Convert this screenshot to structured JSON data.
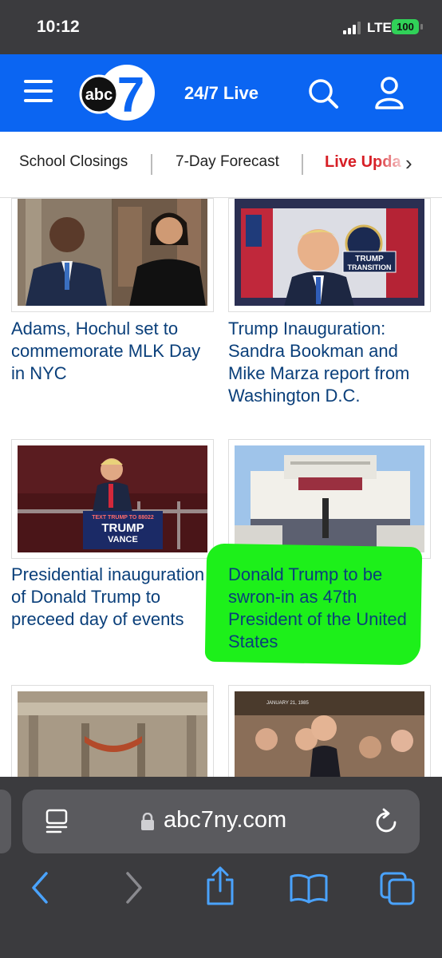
{
  "status": {
    "time": "10:12",
    "network": "LTE",
    "battery": "100"
  },
  "header": {
    "logo_text": "abc",
    "logo_number": "7",
    "live_label": "24/7 Live",
    "icons": {
      "menu": "hamburger-menu-icon",
      "search": "search-icon",
      "account": "user-icon"
    },
    "colors": {
      "brand": "#0b65f2"
    }
  },
  "subnav": {
    "items": [
      "School Closings",
      "7-Day Forecast",
      "Live Upda"
    ],
    "live_color": "#d71f26"
  },
  "articles": [
    {
      "headline": "Adams, Hochul set to commemorate MLK Day in NYC"
    },
    {
      "headline": "Trump Inauguration: Sandra Bookman and Mike Marza report from Washington D.C."
    },
    {
      "headline": "Presidential inauguration of Donald Trump to preceed day of events",
      "sign_line1": "TEXT TRUMP TO 88022",
      "sign_line2": "TRUMP",
      "sign_line3": "VANCE"
    },
    {
      "headline": "Donald Trump to be swron-in as 47th President of the United States",
      "highlighted": true,
      "highlight_color": "#1df01a"
    },
    {
      "headline": ""
    },
    {
      "headline": "",
      "photo_caption": "JANUARY 21, 1985"
    }
  ],
  "graphics": {
    "seal_caption": "TRUMP",
    "seal_caption2": "TRANSITION"
  },
  "browser": {
    "url": "abc7ny.com",
    "toolbar": [
      "back-icon",
      "forward-icon",
      "share-icon",
      "bookmarks-icon",
      "tabs-icon"
    ]
  }
}
